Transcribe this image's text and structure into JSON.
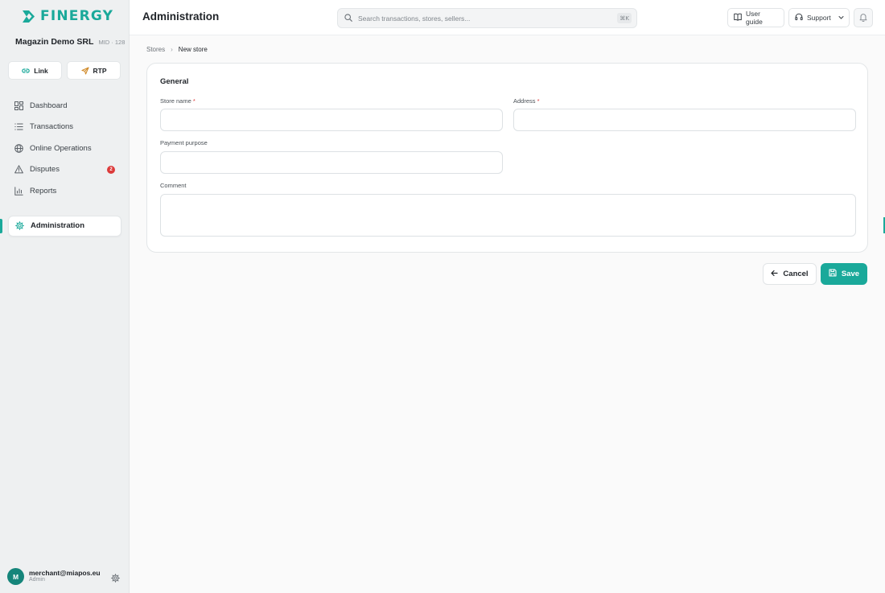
{
  "brand": {
    "name": "FINERGY",
    "accent": "#1aa99a"
  },
  "company": {
    "name": "Magazin Demo SRL",
    "mid": "MID · 128"
  },
  "quick_actions": [
    {
      "label": "Link",
      "icon": "link-icon"
    },
    {
      "label": "RTP",
      "icon": "send-icon"
    }
  ],
  "nav": {
    "items": [
      {
        "label": "Dashboard",
        "icon": "dashboard-icon"
      },
      {
        "label": "Transactions",
        "icon": "list-icon"
      },
      {
        "label": "Online Operations",
        "icon": "globe-icon"
      },
      {
        "label": "Disputes",
        "icon": "warning-icon",
        "badge": "2"
      },
      {
        "label": "Reports",
        "icon": "bar-chart-icon"
      }
    ],
    "active": {
      "label": "Administration",
      "icon": "gear-icon"
    }
  },
  "user": {
    "initial": "M",
    "email": "merchant@miapos.eu",
    "role": "Admin"
  },
  "header": {
    "title": "Administration",
    "search_placeholder": "Search transactions, stores, sellers...",
    "search_shortcut": "⌘K",
    "user_guide": "User guide",
    "support": "Support"
  },
  "breadcrumb": {
    "parent": "Stores",
    "separator": "›",
    "current": "New store"
  },
  "form": {
    "section_title": "General",
    "store_name": {
      "label": "Store name",
      "required_mark": "*",
      "value": ""
    },
    "address": {
      "label": "Address",
      "required_mark": "*",
      "value": ""
    },
    "payment_purpose": {
      "label": "Payment purpose",
      "value": ""
    },
    "comment": {
      "label": "Comment",
      "value": ""
    }
  },
  "actions": {
    "cancel": "Cancel",
    "save": "Save"
  }
}
